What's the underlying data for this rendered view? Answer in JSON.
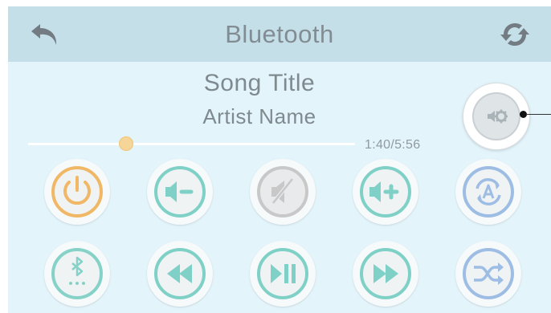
{
  "header": {
    "title": "Bluetooth",
    "back_icon": "back-arrow-icon",
    "refresh_icon": "refresh-icon"
  },
  "track": {
    "title": "Song Title",
    "artist": "Artist Name",
    "time": "1:40/5:56",
    "progress": 0.3
  },
  "settings": {
    "icon": "audio-settings-icon"
  },
  "controls_row1": [
    {
      "name": "power",
      "icon": "power-icon",
      "color": "#f0b866"
    },
    {
      "name": "volume-down",
      "icon": "volume-down-icon",
      "color": "#7fd0c6"
    },
    {
      "name": "mute",
      "icon": "mute-icon",
      "color": "#c8c8c8"
    },
    {
      "name": "volume-up",
      "icon": "volume-up-icon",
      "color": "#7fd0c6"
    },
    {
      "name": "source",
      "icon": "source-a-icon",
      "color": "#9dbde4"
    }
  ],
  "controls_row2": [
    {
      "name": "bluetooth-pair",
      "icon": "bluetooth-icon",
      "color": "#86d2c8"
    },
    {
      "name": "previous",
      "icon": "rewind-icon",
      "color": "#7fd0c6"
    },
    {
      "name": "play-pause",
      "icon": "play-pause-icon",
      "color": "#7fd0c6"
    },
    {
      "name": "next",
      "icon": "fast-forward-icon",
      "color": "#7fd0c6"
    },
    {
      "name": "shuffle",
      "icon": "shuffle-icon",
      "color": "#9dbde4"
    }
  ],
  "colors": {
    "panel_bg": "#e3f4fb",
    "header_bg": "#c5dfe9",
    "text": "#7f8a8f",
    "progress_thumb": "#f6d598"
  }
}
